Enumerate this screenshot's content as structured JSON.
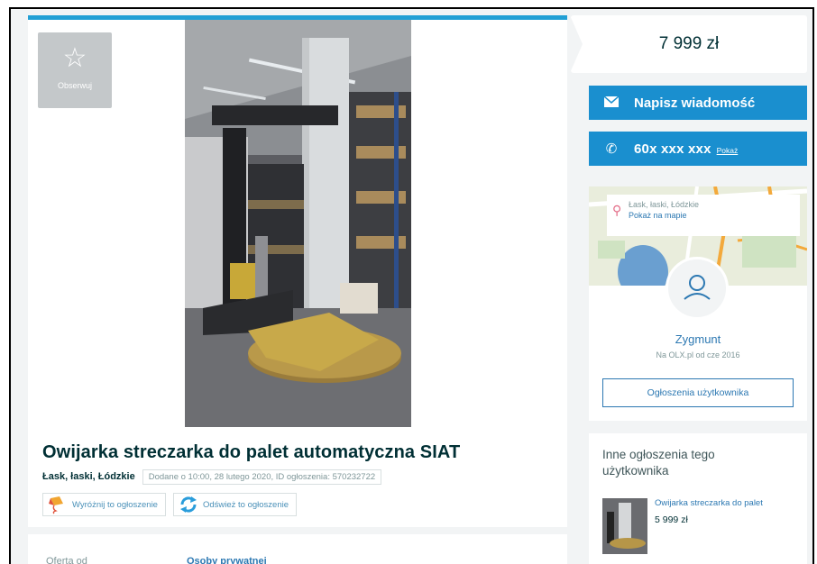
{
  "listing": {
    "observe_label": "Obserwuj",
    "title": "Owijarka streczarka do palet automatyczna SIAT",
    "location": "Łask, łaski, Łódzkie",
    "added": "Dodane o 10:00, 28 lutego 2020, ID ogłoszenia: 570232722",
    "highlight_button": "Wyróżnij to ogłoszenie",
    "refresh_button": "Odśwież to ogłoszenie",
    "details": [
      {
        "key": "Oferta od",
        "value": "Osoby prywatnej"
      }
    ]
  },
  "sidebar": {
    "price": "7 999 zł",
    "message_button": "Napisz wiadomość",
    "phone_number": "60x xxx xxx",
    "phone_show": "Pokaż",
    "map_city": "Łask, łaski, Łódzkie",
    "map_show": "Pokaż na mapie",
    "user_name": "Zygmunt",
    "user_since": "Na OLX.pl od cze 2016",
    "user_ads_button": "Ogłoszenia użytkownika",
    "other_title": "Inne ogłoszenia tego użytkownika",
    "other_items": [
      {
        "title": "Owijarka streczarka do palet",
        "price": "5 999 zł"
      }
    ]
  },
  "colors": {
    "accent_blue": "#1a8fcf",
    "top_bar": "#23a0d5",
    "link_blue": "#2c78b2",
    "pin_pink": "#e36b86"
  },
  "icons": {
    "observe": "star-outline-icon",
    "message": "envelope-icon",
    "phone": "phone-icon",
    "location": "map-pin-icon",
    "avatar": "user-outline-icon",
    "highlight": "kite-icon",
    "refresh": "refresh-arrows-icon"
  }
}
